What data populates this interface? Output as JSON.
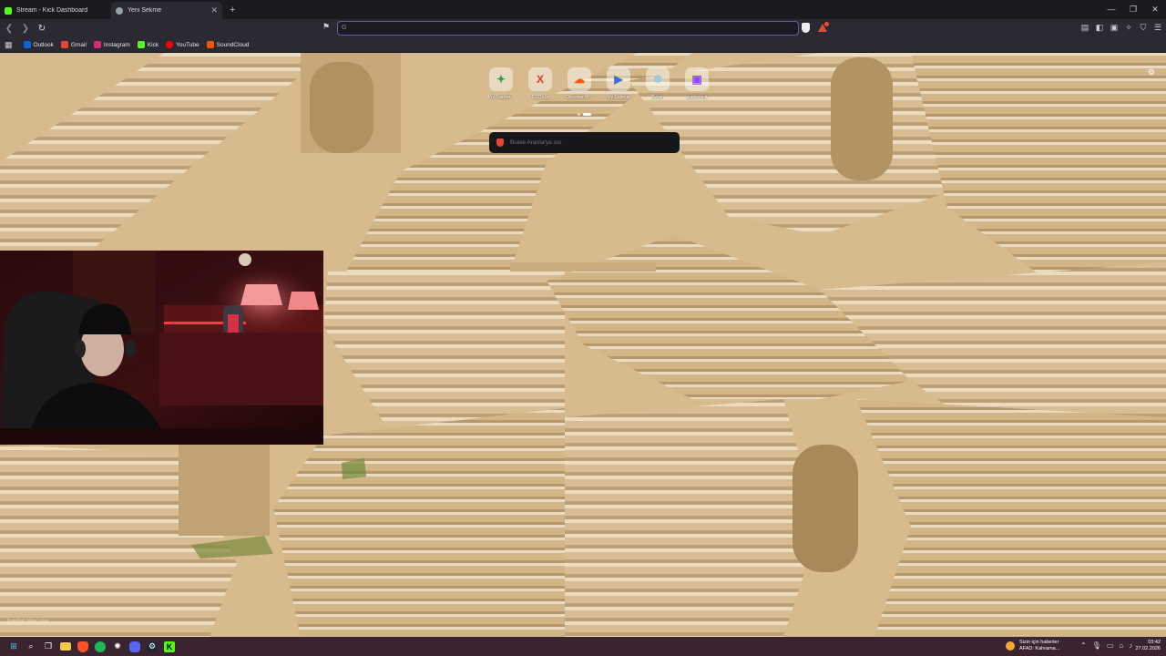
{
  "browser": {
    "tabs": [
      {
        "title": "Stream - Kick Dashboard",
        "active": false,
        "favicon_color": "#53fc18"
      },
      {
        "title": "Yeni Sekme",
        "active": true,
        "favicon_color": "#9aa0a6"
      }
    ],
    "address_bar": {
      "value": "",
      "placeholder": ""
    },
    "bookmarks": [
      {
        "label": "Outlook",
        "color": "#0a64d6"
      },
      {
        "label": "Gmail",
        "color": "#ea4335"
      },
      {
        "label": "Instagram",
        "color": "#d62976"
      },
      {
        "label": "Kick",
        "color": "#53fc18"
      },
      {
        "label": "YouTube",
        "color": "#ff0000"
      },
      {
        "label": "SoundCloud",
        "color": "#ff5500"
      }
    ]
  },
  "new_tab": {
    "shortcuts": [
      {
        "label": "ProTracker...",
        "icon": "protracker-icon",
        "glyph": "✦",
        "color": "#2f9e44"
      },
      {
        "label": "1337x.to",
        "icon": "1337x-icon",
        "glyph": "X",
        "color": "#e0392b"
      },
      {
        "label": "Discover th...",
        "icon": "soundcloud-icon",
        "glyph": "☁",
        "color": "#ff5500"
      },
      {
        "label": "My Listings",
        "icon": "listings-icon",
        "glyph": "▶",
        "color": "#3b6fd8"
      },
      {
        "label": "Bwain",
        "icon": "snowflake-icon",
        "glyph": "❄",
        "color": "#8ecae6"
      },
      {
        "label": "sunkenmir",
        "icon": "twitch-icon",
        "glyph": "▣",
        "color": "#9146ff"
      }
    ],
    "search": {
      "placeholder": "Brave Arama'ya sor"
    },
    "photo_credit": "Fotoğraf: Nida Lolog"
  },
  "taskbar": {
    "news_title": "Sizin için haberler",
    "news_sub": "AFAD: Kahrama...",
    "time": "03:42",
    "date": "27.02.2026"
  }
}
